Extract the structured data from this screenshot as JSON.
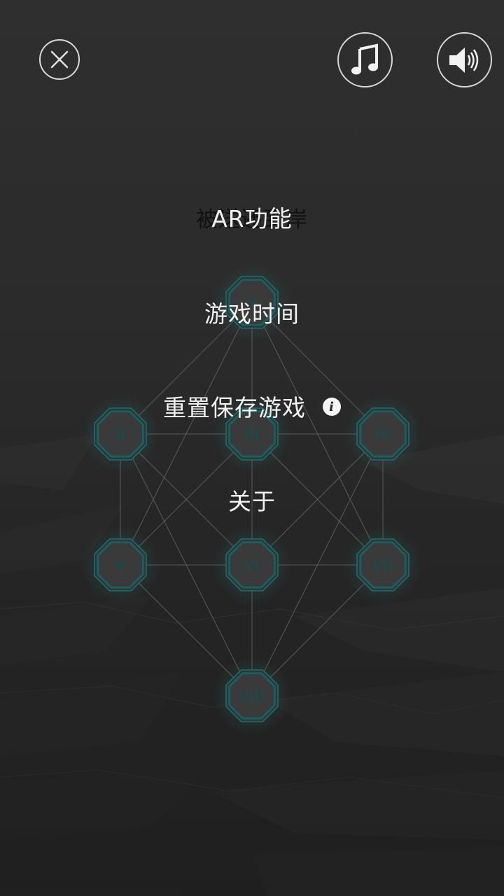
{
  "toolbar": {
    "close_icon": "close-icon",
    "music_icon": "music-note-icon",
    "sound_icon": "speaker-icon"
  },
  "background_subtitle": "被送还到岸",
  "menu": {
    "ar_label": "AR功能",
    "playtime_label": "游戏时间",
    "reset_label": "重置保存游戏",
    "reset_info_glyph": "i",
    "about_label": "关于"
  },
  "level_map": {
    "nodes": [
      {
        "id": "i",
        "label": "i"
      },
      {
        "id": "ii",
        "label": "ii"
      },
      {
        "id": "iii",
        "label": "iii"
      },
      {
        "id": "iv",
        "label": "iv"
      },
      {
        "id": "v",
        "label": "v"
      },
      {
        "id": "vi",
        "label": "vi"
      },
      {
        "id": "vii",
        "label": "vii"
      },
      {
        "id": "viii",
        "label": "viii"
      }
    ],
    "edges": [
      [
        "i",
        "ii"
      ],
      [
        "i",
        "iii"
      ],
      [
        "i",
        "iv"
      ],
      [
        "i",
        "v"
      ],
      [
        "i",
        "vi"
      ],
      [
        "i",
        "vii"
      ],
      [
        "ii",
        "iii"
      ],
      [
        "iii",
        "iv"
      ],
      [
        "ii",
        "v"
      ],
      [
        "iv",
        "vii"
      ],
      [
        "ii",
        "vi"
      ],
      [
        "iv",
        "vi"
      ],
      [
        "ii",
        "viii"
      ],
      [
        "iv",
        "viii"
      ],
      [
        "iii",
        "v"
      ],
      [
        "iii",
        "vii"
      ],
      [
        "iii",
        "vi"
      ],
      [
        "v",
        "vi"
      ],
      [
        "vi",
        "vii"
      ],
      [
        "v",
        "viii"
      ],
      [
        "vi",
        "viii"
      ],
      [
        "vii",
        "viii"
      ]
    ]
  },
  "colors": {
    "accent": "#1f6f6f",
    "node_fill": "#3a3a3a",
    "glow": "#2a8a8a"
  }
}
